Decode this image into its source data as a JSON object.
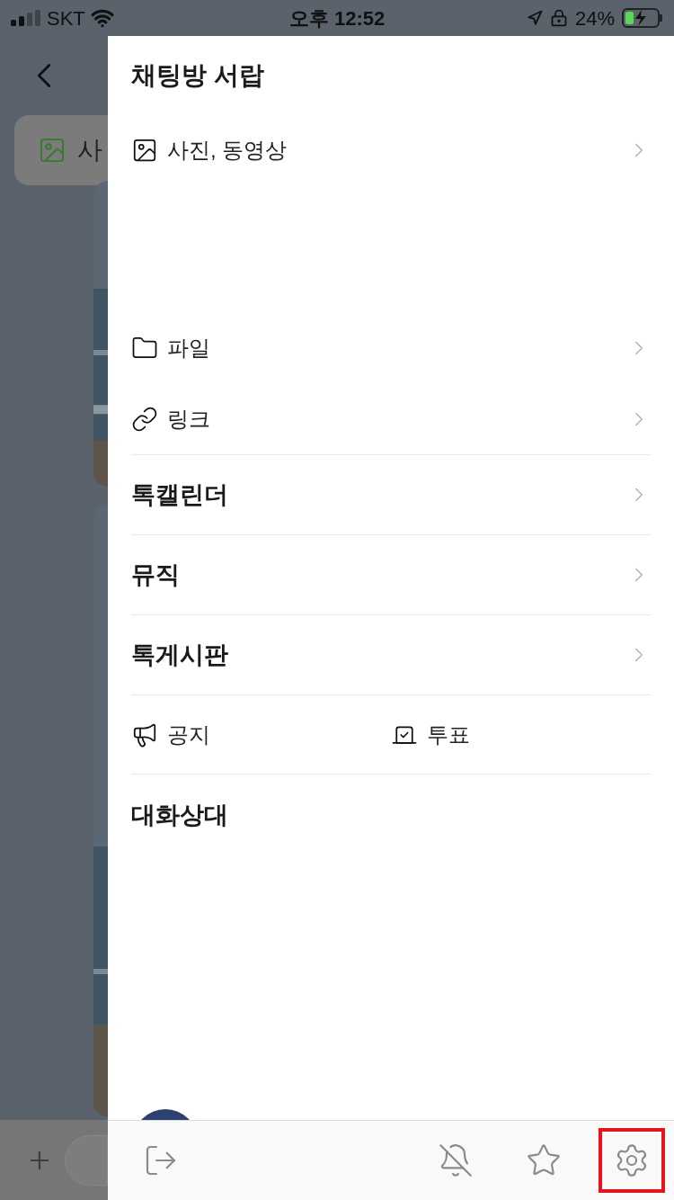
{
  "status_bar": {
    "carrier": "SKT",
    "time": "오후 12:52",
    "battery": "24%"
  },
  "background": {
    "chip_label": "사"
  },
  "drawer": {
    "title": "채팅방 서랍",
    "items": [
      {
        "kind": "media",
        "label": "사진, 동영상"
      },
      {
        "kind": "file",
        "label": "파일"
      },
      {
        "kind": "link",
        "label": "링크"
      },
      {
        "kind": "section",
        "label": "톡캘린더"
      },
      {
        "kind": "section",
        "label": "뮤직"
      },
      {
        "kind": "section",
        "label": "톡게시판"
      },
      {
        "kind": "pair",
        "labels": [
          "공지",
          "투표"
        ]
      },
      {
        "kind": "header",
        "label": "대화상대"
      }
    ],
    "toolbar": [
      {
        "kind": "leave",
        "highlighted": false
      },
      {
        "kind": "mute",
        "highlighted": false
      },
      {
        "kind": "favorite",
        "highlighted": false
      },
      {
        "kind": "settings",
        "highlighted": true
      }
    ]
  }
}
